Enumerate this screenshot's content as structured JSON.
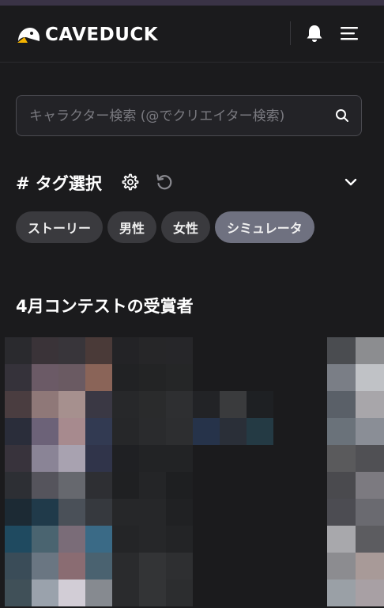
{
  "header": {
    "brand": "CAVEDUCK"
  },
  "search": {
    "placeholder": "キャラクター検索 (@でクリエイター検索)"
  },
  "tags": {
    "title": "# タグ選択",
    "chips": [
      {
        "label": "ストーリー",
        "active": false
      },
      {
        "label": "男性",
        "active": false
      },
      {
        "label": "女性",
        "active": false
      },
      {
        "label": "シミュレータ",
        "active": true
      }
    ]
  },
  "contest": {
    "title": "4月コンテストの受賞者"
  },
  "colors": {
    "background": "#1b1b1d",
    "chip": "#3a3a3e",
    "chip_active": "#6f7180",
    "border": "#4a4a50"
  },
  "icons": [
    "duck-logo-icon",
    "bell-icon",
    "hamburger-menu-icon",
    "search-icon",
    "gear-icon",
    "reset-icon",
    "chevron-down-icon"
  ]
}
